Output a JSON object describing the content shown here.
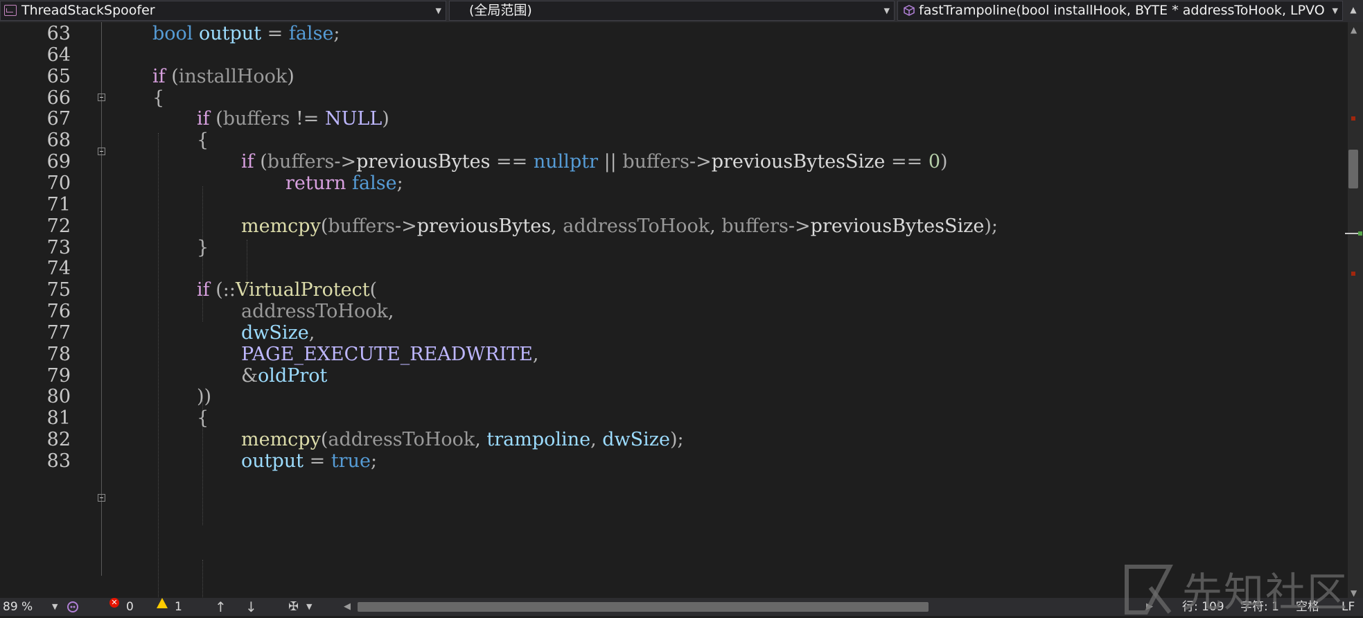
{
  "navbar": {
    "project": "ThreadStackSpoofer",
    "scope": "(全局范围)",
    "member": "fastTrampoline(bool installHook, BYTE * addressToHook, LPVOID jum"
  },
  "editor": {
    "lines": [
      {
        "n": "63",
        "indent": 0,
        "tokens": [
          [
            "kw",
            "bool"
          ],
          [
            "vr",
            " output"
          ],
          [
            "punc",
            " = "
          ],
          [
            "kw",
            "false"
          ],
          [
            "punc",
            ";"
          ]
        ]
      },
      {
        "n": "64",
        "indent": 0,
        "tokens": []
      },
      {
        "n": "65",
        "indent": 0,
        "tokens": [
          [
            "ctl",
            "if"
          ],
          [
            "punc",
            " ("
          ],
          [
            "par",
            "installHook"
          ],
          [
            "punc",
            ")"
          ]
        ]
      },
      {
        "n": "66",
        "indent": 0,
        "tokens": [
          [
            "punc",
            "{"
          ]
        ]
      },
      {
        "n": "67",
        "indent": 1,
        "tokens": [
          [
            "ctl",
            "if"
          ],
          [
            "punc",
            " ("
          ],
          [
            "par",
            "buffers"
          ],
          [
            "punc",
            " != "
          ],
          [
            "mac",
            "NULL"
          ],
          [
            "punc",
            ")"
          ]
        ]
      },
      {
        "n": "68",
        "indent": 1,
        "tokens": [
          [
            "punc",
            "{"
          ]
        ]
      },
      {
        "n": "69",
        "indent": 2,
        "tokens": [
          [
            "ctl",
            "if"
          ],
          [
            "punc",
            " ("
          ],
          [
            "par",
            "buffers"
          ],
          [
            "punc",
            "->"
          ],
          [
            "mem",
            "previousBytes"
          ],
          [
            "punc",
            " == "
          ],
          [
            "kw",
            "nullptr"
          ],
          [
            "punc",
            " || "
          ],
          [
            "par",
            "buffers"
          ],
          [
            "punc",
            "->"
          ],
          [
            "mem",
            "previousBytesSize"
          ],
          [
            "punc",
            " == "
          ],
          [
            "num",
            "0"
          ],
          [
            "punc",
            ")"
          ]
        ]
      },
      {
        "n": "70",
        "indent": 3,
        "tokens": [
          [
            "ctl",
            "return"
          ],
          [
            "kw",
            " false"
          ],
          [
            "punc",
            ";"
          ]
        ]
      },
      {
        "n": "71",
        "indent": 0,
        "tokens": []
      },
      {
        "n": "72",
        "indent": 2,
        "tokens": [
          [
            "fn",
            "memcpy"
          ],
          [
            "punc",
            "("
          ],
          [
            "par",
            "buffers"
          ],
          [
            "punc",
            "->"
          ],
          [
            "mem",
            "previousBytes"
          ],
          [
            "punc",
            ", "
          ],
          [
            "par",
            "addressToHook"
          ],
          [
            "punc",
            ", "
          ],
          [
            "par",
            "buffers"
          ],
          [
            "punc",
            "->"
          ],
          [
            "mem",
            "previousBytesSize"
          ],
          [
            "punc",
            ");"
          ]
        ]
      },
      {
        "n": "73",
        "indent": 1,
        "tokens": [
          [
            "punc",
            "}"
          ]
        ]
      },
      {
        "n": "74",
        "indent": 0,
        "tokens": []
      },
      {
        "n": "75",
        "indent": 1,
        "tokens": [
          [
            "ctl",
            "if"
          ],
          [
            "punc",
            " (::"
          ],
          [
            "fn",
            "VirtualProtect"
          ],
          [
            "punc",
            "("
          ]
        ]
      },
      {
        "n": "76",
        "indent": 2,
        "tokens": [
          [
            "par",
            "addressToHook"
          ],
          [
            "punc",
            ","
          ]
        ]
      },
      {
        "n": "77",
        "indent": 2,
        "tokens": [
          [
            "vr",
            "dwSize"
          ],
          [
            "punc",
            ","
          ]
        ]
      },
      {
        "n": "78",
        "indent": 2,
        "tokens": [
          [
            "mac",
            "PAGE_EXECUTE_READWRITE"
          ],
          [
            "punc",
            ","
          ]
        ]
      },
      {
        "n": "79",
        "indent": 2,
        "tokens": [
          [
            "punc",
            "&"
          ],
          [
            "vr",
            "oldProt"
          ]
        ]
      },
      {
        "n": "80",
        "indent": 1,
        "tokens": [
          [
            "punc",
            "))"
          ]
        ]
      },
      {
        "n": "81",
        "indent": 1,
        "tokens": [
          [
            "punc",
            "{"
          ]
        ]
      },
      {
        "n": "82",
        "indent": 2,
        "tokens": [
          [
            "fn",
            "memcpy"
          ],
          [
            "punc",
            "("
          ],
          [
            "par",
            "addressToHook"
          ],
          [
            "punc",
            ", "
          ],
          [
            "vr",
            "trampoline"
          ],
          [
            "punc",
            ", "
          ],
          [
            "vr",
            "dwSize"
          ],
          [
            "punc",
            ");"
          ]
        ]
      },
      {
        "n": "83",
        "indent": 2,
        "tokens": [
          [
            "vr",
            "output"
          ],
          [
            "punc",
            " = "
          ],
          [
            "kw",
            "true"
          ],
          [
            "punc",
            ";"
          ]
        ]
      }
    ]
  },
  "status": {
    "zoom": "89 %",
    "errors": "0",
    "warnings": "1",
    "line": "行: 109",
    "col": "字符: 1",
    "spaces": "空格",
    "eol": "LF"
  },
  "watermark": "先知社区",
  "colors": {
    "background": "#1e1e1e",
    "keyword": "#569cd6",
    "control": "#d8a0df",
    "function": "#dcdcaa",
    "parameter": "#9a9a9a",
    "variable": "#9cdcfe",
    "macro": "#beb7ff",
    "number": "#b5cea8"
  }
}
